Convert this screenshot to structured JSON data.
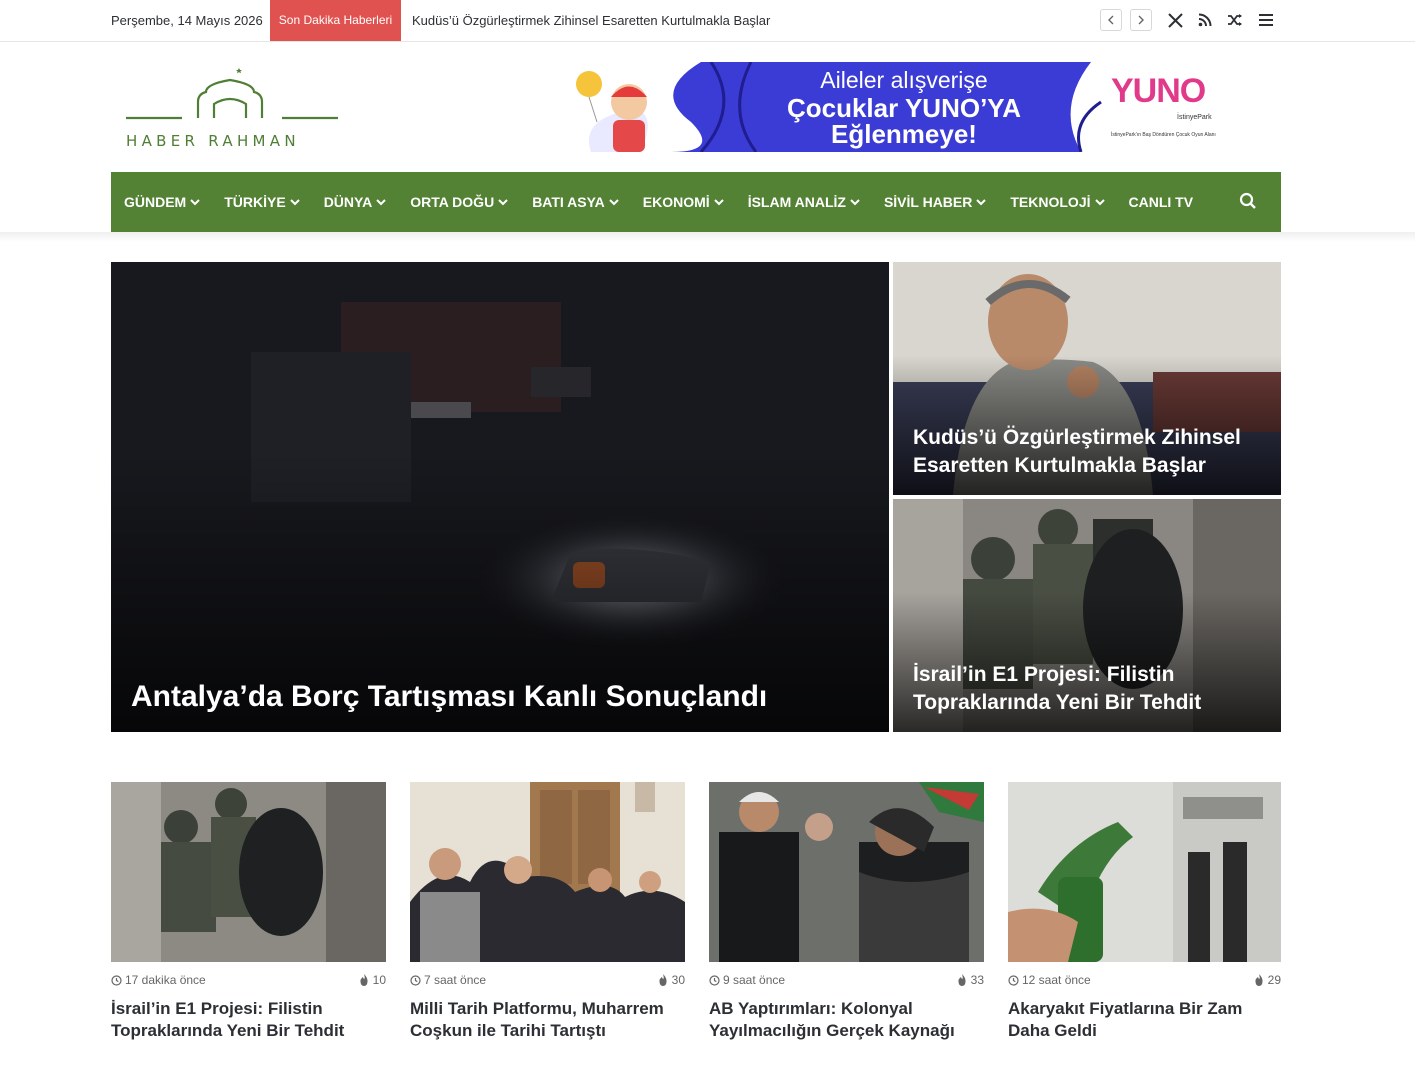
{
  "topbar": {
    "date": "Perşembe, 14 Mayıs 2026",
    "breaking_label": "Son Dakika Haberleri",
    "breaking_text": "Kudüs’ü Özgürleştirmek Zihinsel Esaretten Kurtulmakla Başlar",
    "icons": [
      "chevron-left-icon",
      "chevron-right-icon",
      "x-icon",
      "rss-icon",
      "shuffle-icon",
      "menu-icon"
    ]
  },
  "logo": {
    "text": "HABER RAHMAN"
  },
  "banner": {
    "line1": "Aileler alışverişe",
    "line2": "Çocuklar YUNO’YA",
    "line3": "Eğlenmeye!",
    "brand": "YUNO",
    "brand_sub": "İstinyePark",
    "brand_caption": "İstinyePark’ın Baş Döndüren Çocuk Oyun Alanı"
  },
  "nav": {
    "items": [
      {
        "label": "GÜNDEM",
        "dropdown": true
      },
      {
        "label": "TÜRKİYE",
        "dropdown": true
      },
      {
        "label": "DÜNYA",
        "dropdown": true
      },
      {
        "label": "ORTA DOĞU",
        "dropdown": true
      },
      {
        "label": "BATI ASYA",
        "dropdown": true
      },
      {
        "label": "EKONOMİ",
        "dropdown": true
      },
      {
        "label": "İSLAM ANALİZ",
        "dropdown": true
      },
      {
        "label": "SİVİL HABER",
        "dropdown": true
      },
      {
        "label": "TEKNOLOJİ",
        "dropdown": true
      },
      {
        "label": "CANLI TV",
        "dropdown": false
      }
    ],
    "search_icon": "search-icon"
  },
  "hero": {
    "main_title": "Antalya’da Borç Tartışması Kanlı Sonuçlandı",
    "side1_title": "Kudüs’ü Özgürleştirmek Zihinsel Esaretten Kurtulmakla Başlar",
    "side2_title": "İsrail’in E1 Projesi: Filistin Topraklarında Yeni Bir Tehdit"
  },
  "cards": [
    {
      "time": "17 dakika önce",
      "views": "10",
      "title": "İsrail’in E1 Projesi: Filistin Topraklarında Yeni Bir Tehdit"
    },
    {
      "time": "7 saat önce",
      "views": "30",
      "title": "Milli Tarih Platformu, Muharrem Coşkun ile Tarihi Tartıştı"
    },
    {
      "time": "9 saat önce",
      "views": "33",
      "title": "AB Yaptırımları: Kolonyal Yayılmacılığın Gerçek Kaynağı"
    },
    {
      "time": "12 saat önce",
      "views": "29",
      "title": "Akaryakıt Fiyatlarına Bir Zam Daha Geldi"
    }
  ],
  "colors": {
    "brand_green": "#538235",
    "breaking_red": "#e0524f",
    "banner_blue": "#3b3bd6"
  }
}
